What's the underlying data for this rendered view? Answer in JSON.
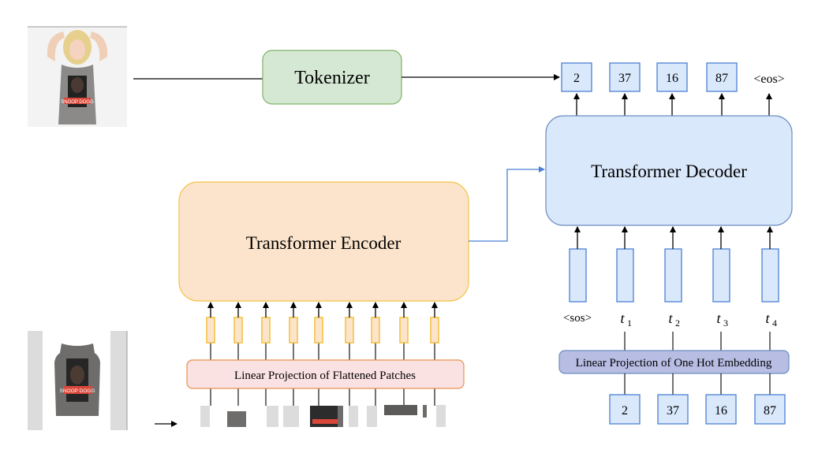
{
  "colors": {
    "tokenizer_fill": "#d5e8d4",
    "tokenizer_stroke": "#82b366",
    "encoder_fill": "#fce4cc",
    "encoder_stroke": "#f5c342",
    "decoder_fill": "#dae8fc",
    "decoder_stroke": "#6c8ebf",
    "patch_proj_fill": "#fbe2e2",
    "patch_proj_stroke": "#e8914f",
    "onehot_proj_fill": "#b8bde3",
    "onehot_proj_stroke": "#6c8ebf",
    "token_fill": "#dae8fc",
    "token_stroke": "#4a7fd4",
    "patch_emb_fill": "#fce4cc",
    "patch_emb_stroke": "#f5c342",
    "connector_blue": "#4a7fd4"
  },
  "tokenizer": {
    "label": "Tokenizer"
  },
  "encoder": {
    "label": "Transformer Encoder"
  },
  "decoder": {
    "label": "Transformer Decoder"
  },
  "patch_projection": {
    "label": "Linear Projection of Flattened Patches"
  },
  "onehot_projection": {
    "label": "Linear Projection of One Hot Embedding"
  },
  "output_tokens": [
    "2",
    "37",
    "16",
    "87"
  ],
  "eos_label": "<eos>",
  "sos_label": "<sos>",
  "input_token_labels": [
    {
      "base": "t",
      "sub": "1"
    },
    {
      "base": "t",
      "sub": "2"
    },
    {
      "base": "t",
      "sub": "3"
    },
    {
      "base": "t",
      "sub": "4"
    }
  ],
  "input_token_ids": [
    "2",
    "37",
    "16",
    "87"
  ],
  "patch_count": 9,
  "images": {
    "top": "model-wearing-snoop-dogg-tank-top-photo",
    "bottom": "snoop-dogg-tank-top-product-photo"
  },
  "shirt_print_text": "SNOOP DOGG"
}
